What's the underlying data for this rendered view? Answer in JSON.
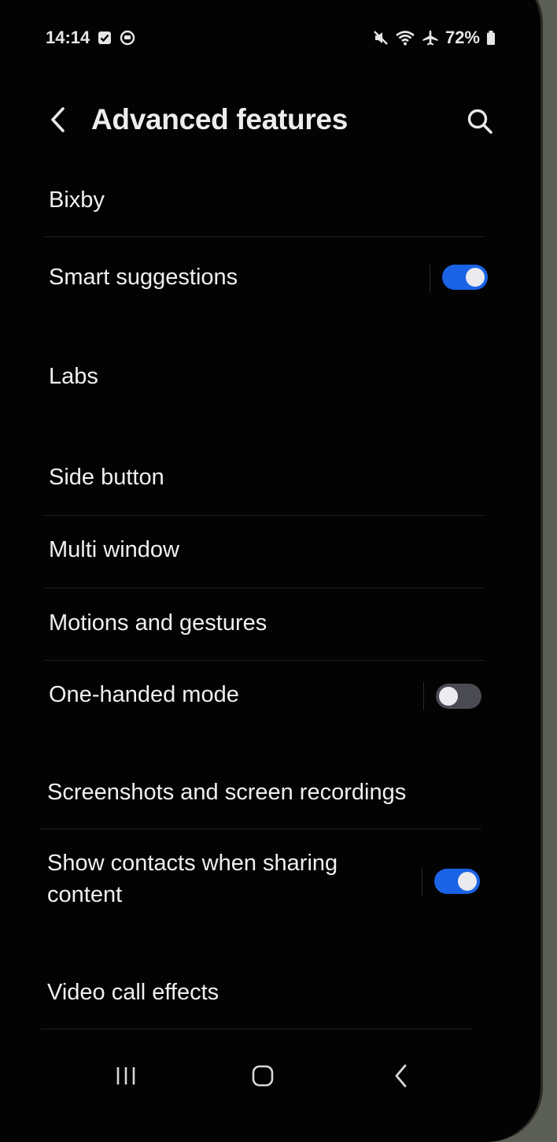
{
  "status_bar": {
    "time": "14:14",
    "battery": "72%",
    "icons": [
      "checkbox-notification-icon",
      "clock-notification-icon",
      "mute-icon",
      "wifi-icon",
      "airplane-icon",
      "battery-icon"
    ]
  },
  "header": {
    "title": "Advanced features",
    "back_icon": "chevron-left-icon",
    "search_icon": "search-icon"
  },
  "items": [
    {
      "label": "Bixby",
      "toggle": null
    },
    {
      "label": "Smart suggestions",
      "toggle": true
    },
    {
      "label": "Labs",
      "toggle": null
    },
    {
      "label": "Side button",
      "toggle": null
    },
    {
      "label": "Multi window",
      "toggle": null
    },
    {
      "label": "Motions and gestures",
      "toggle": null
    },
    {
      "label": "One-handed mode",
      "toggle": false
    },
    {
      "label": "Screenshots and screen recordings",
      "toggle": null
    },
    {
      "label": "Show contacts when sharing content",
      "label_lines": [
        "Show contacts when sharing",
        "content"
      ],
      "toggle": true
    },
    {
      "label": "Video call effects",
      "toggle": null
    }
  ],
  "nav_bar": {
    "recents_icon": "recents-icon",
    "home_icon": "home-icon",
    "back_icon": "back-icon"
  },
  "colors": {
    "background": "#030303",
    "toggle_on": "#1a63e6",
    "toggle_off": "#4a4a52",
    "text": "#efefef"
  }
}
